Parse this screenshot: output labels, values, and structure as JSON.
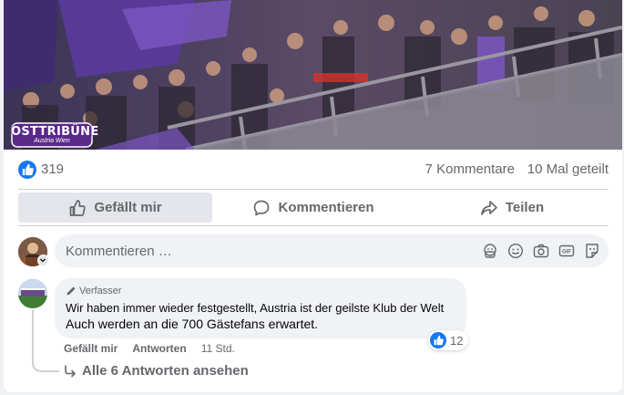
{
  "post": {
    "image": {
      "logo_text": "OSTTRIBÜNE",
      "logo_subtext": "Austria Wien"
    },
    "stats": {
      "reaction_icon": "thumbs-up-icon",
      "like_count": "319",
      "comments": "7 Kommentare",
      "shares": "10 Mal geteilt"
    },
    "actions": {
      "like_label": "Gefällt mir",
      "comment_label": "Kommentieren",
      "share_label": "Teilen"
    },
    "composer": {
      "placeholder": "Kommentieren …",
      "icons": [
        "avatar-sticker-icon",
        "emoji-icon",
        "camera-icon",
        "gif-icon",
        "sticker-icon"
      ]
    },
    "comment": {
      "badge": "Verfasser",
      "line1": "Wir haben immer wieder festgestellt, Austria ist der geilste Klub der Welt",
      "line2": "Auch werden an die 700 Gästefans erwartet.",
      "reaction_count": "12",
      "like_label": "Gefällt mir",
      "reply_label": "Antworten",
      "time": "11 Std.",
      "view_replies": "Alle 6 Antworten ansehen"
    }
  },
  "colors": {
    "facebook_blue": "#1877f2",
    "secondary_text": "#65676b",
    "bubble_bg": "#f0f2f5",
    "active_button_bg": "#e4e6eb"
  }
}
